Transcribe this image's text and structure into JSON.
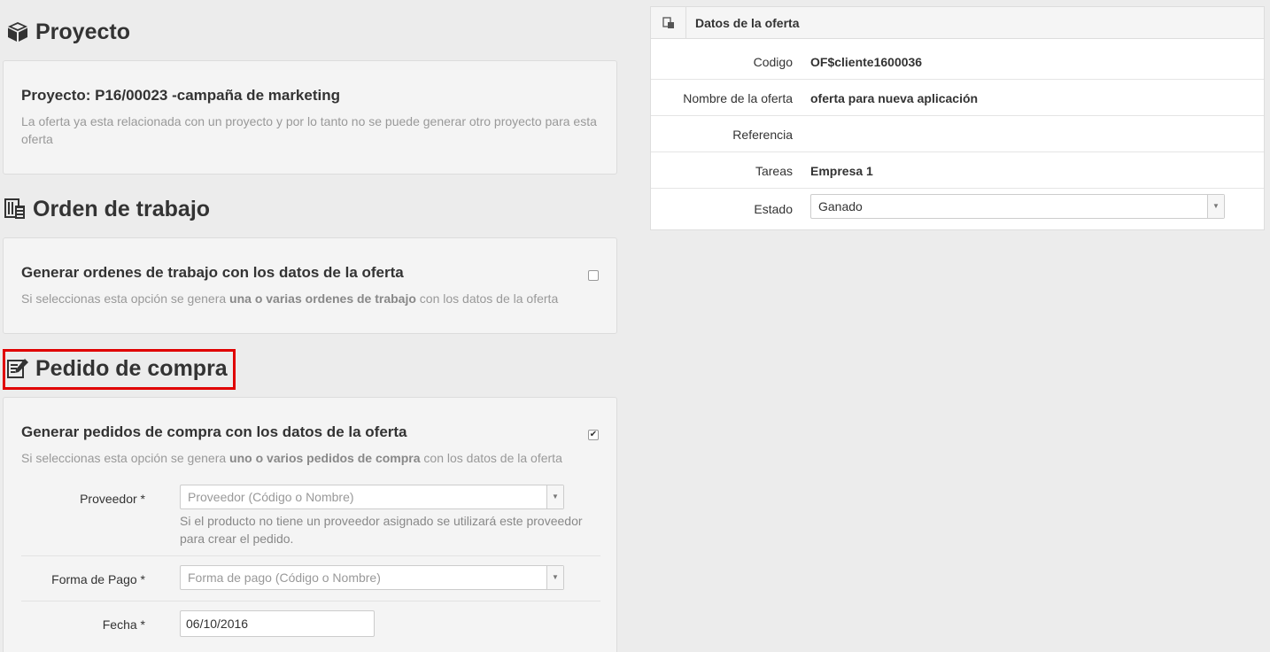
{
  "proyecto": {
    "heading": "Proyecto",
    "card_title": "Proyecto: P16/00023 -campaña de marketing",
    "card_desc": "La oferta ya esta relacionada con un proyecto y por lo tanto no se puede generar otro proyecto para esta oferta"
  },
  "orden": {
    "heading": "Orden de trabajo",
    "card_title": "Generar ordenes de trabajo con los datos de la oferta",
    "desc_prefix": "Si seleccionas esta opción se genera ",
    "desc_bold": "una o varias ordenes de trabajo",
    "desc_suffix": " con los datos de la oferta",
    "checked": false
  },
  "pedido": {
    "heading": "Pedido de compra",
    "card_title": "Generar pedidos de compra con los datos de la oferta",
    "desc_prefix": "Si seleccionas esta opción se genera ",
    "desc_bold": "uno o varios pedidos de compra",
    "desc_suffix": " con los datos de la oferta",
    "checked": true,
    "checkmark": "✔",
    "proveedor_label": "Proveedor *",
    "proveedor_placeholder": "Proveedor (Código o Nombre)",
    "proveedor_help": "Si el producto no tiene un proveedor asignado se utilizará este proveedor para crear el pedido.",
    "pago_label": "Forma de Pago *",
    "pago_placeholder": "Forma de pago (Código o Nombre)",
    "fecha_label": "Fecha *",
    "fecha_value": "06/10/2016"
  },
  "oferta": {
    "title": "Datos de la oferta",
    "rows": [
      {
        "label": "Codigo",
        "value": "OF$cliente1600036"
      },
      {
        "label": "Nombre de la oferta",
        "value": "oferta para nueva aplicación"
      },
      {
        "label": "Referencia",
        "value": ""
      },
      {
        "label": "Tareas",
        "value": "Empresa 1"
      }
    ],
    "estado_label": "Estado",
    "estado_value": "Ganado"
  },
  "colors": {
    "highlight": "#e00000",
    "background": "#ececec"
  }
}
